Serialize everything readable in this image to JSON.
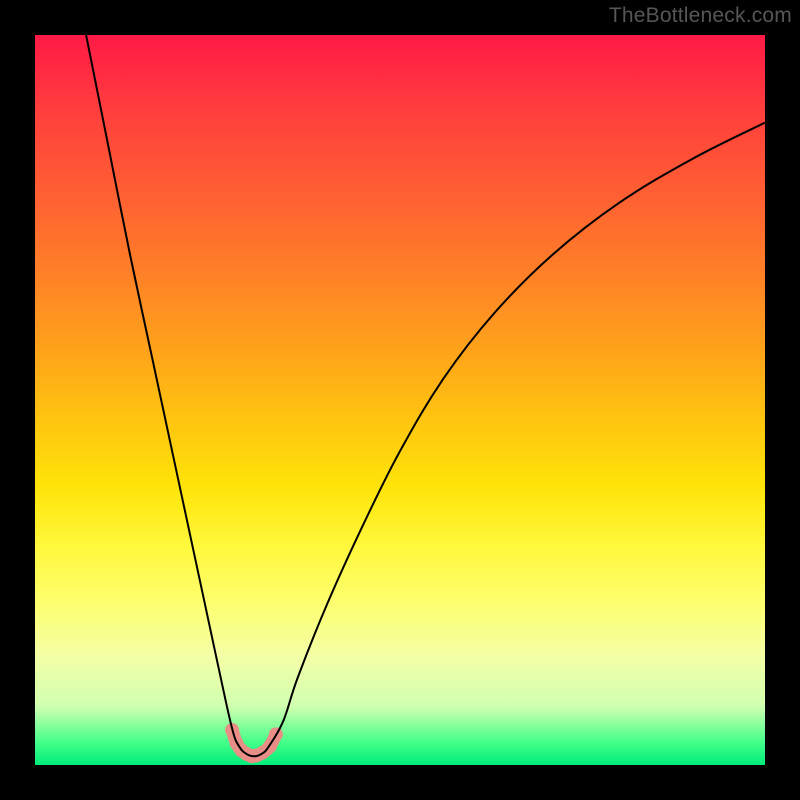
{
  "watermark": "TheBottleneck.com",
  "chart_data": {
    "type": "line",
    "title": "",
    "xlabel": "",
    "ylabel": "",
    "xlim": [
      0,
      100
    ],
    "ylim": [
      0,
      100
    ],
    "series": [
      {
        "name": "bottleneck-curve",
        "x": [
          7,
          10,
          13,
          16,
          19,
          22,
          25,
          27,
          28,
          29,
          30,
          31,
          32,
          34,
          36,
          40,
          45,
          50,
          56,
          63,
          71,
          80,
          90,
          100
        ],
        "y": [
          100,
          85,
          70,
          56,
          42,
          28,
          14,
          5,
          2.5,
          1.5,
          1.2,
          1.5,
          2.5,
          6,
          12,
          22,
          33,
          43,
          53,
          62,
          70,
          77,
          83,
          88
        ],
        "color": "#000000",
        "stroke_width_px": 2
      },
      {
        "name": "bottleneck-dip-highlight",
        "x": [
          27.0,
          27.6,
          28.3,
          29.0,
          29.7,
          30.3,
          31.2,
          32.2,
          33.0
        ],
        "y": [
          4.8,
          3.0,
          2.0,
          1.5,
          1.2,
          1.3,
          1.7,
          2.6,
          4.2
        ],
        "color": "#e98d87",
        "stroke_width_px": 13,
        "marker": "circle"
      }
    ],
    "notes": "Vertical gradient background from red (high bottleneck) through orange/yellow to green (low bottleneck). The black curve dips to a minimum around x≈30, highlighted with a thick salmon U-shaped marker stroke near the bottom."
  },
  "gradient_stops": [
    {
      "pct": 0,
      "hex": "#ff1a46"
    },
    {
      "pct": 9,
      "hex": "#ff3a3e"
    },
    {
      "pct": 20,
      "hex": "#ff5a34"
    },
    {
      "pct": 32,
      "hex": "#ff7e28"
    },
    {
      "pct": 43,
      "hex": "#ffa21a"
    },
    {
      "pct": 54,
      "hex": "#ffc90e"
    },
    {
      "pct": 62,
      "hex": "#ffe409"
    },
    {
      "pct": 70,
      "hex": "#fff83c"
    },
    {
      "pct": 78,
      "hex": "#fdff70"
    },
    {
      "pct": 85,
      "hex": "#f4ffa6"
    },
    {
      "pct": 92,
      "hex": "#d0ffb0"
    },
    {
      "pct": 97,
      "hex": "#40ff88"
    },
    {
      "pct": 100,
      "hex": "#00ec7a"
    }
  ]
}
